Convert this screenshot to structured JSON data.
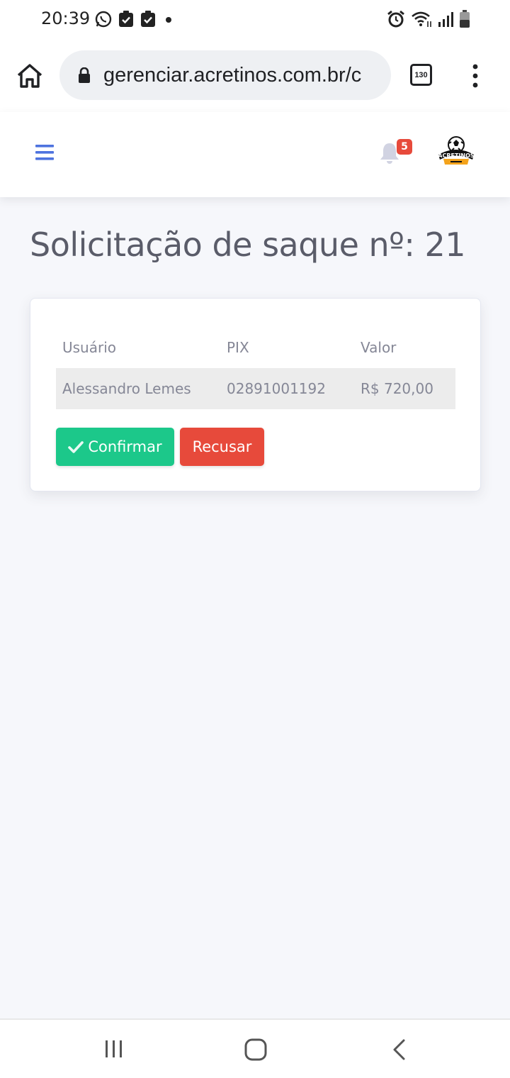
{
  "status_bar": {
    "time": "20:39"
  },
  "browser": {
    "url": "gerenciar.acretinos.com.br/c",
    "tab_count": "130"
  },
  "topbar": {
    "notification_count": "5",
    "logo_text": "ACRETINOS"
  },
  "page": {
    "title": "Solicitação de saque nº: 21"
  },
  "table": {
    "headers": [
      "Usuário",
      "PIX",
      "Valor"
    ],
    "rows": [
      [
        "Alessandro Lemes",
        "02891001192",
        "R$ 720,00"
      ]
    ]
  },
  "actions": {
    "confirm_label": "Confirmar",
    "reject_label": "Recusar"
  },
  "colors": {
    "primary": "#4e73df",
    "success": "#1cc88a",
    "danger": "#e74a3b",
    "background": "#f6f7fb"
  }
}
